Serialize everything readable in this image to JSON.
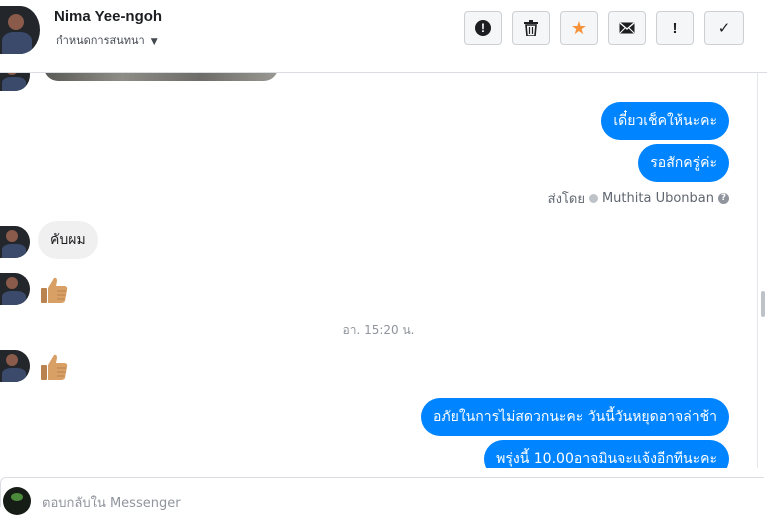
{
  "header": {
    "contact_name": "Nima Yee-ngoh",
    "subtitle": "กำหนดการสนทนา",
    "buttons": [
      {
        "icon": "exclamation-circle-icon",
        "glyph": "!"
      },
      {
        "icon": "trash-icon",
        "glyph": "🗑"
      },
      {
        "icon": "star-icon",
        "glyph": "★"
      },
      {
        "icon": "envelope-icon",
        "glyph": "✉"
      },
      {
        "icon": "exclamation-icon",
        "glyph": "!"
      },
      {
        "icon": "checkmark-icon",
        "glyph": "✓"
      }
    ]
  },
  "thread": {
    "outgoing_1": "เดี๋ยวเช็คให้นะคะ",
    "outgoing_2": "รอสักครู่ค่ะ",
    "sent_by_label": "ส่งโดย",
    "sent_by_name": "Muthita Ubonban",
    "incoming_1": "คับผม",
    "timestamp": "อา. 15:20 น.",
    "outgoing_3": "อภัยในการไม่สดวกนะคะ วันนี้วันหยุดอาจล่าช้า",
    "outgoing_4": "พรุ่งนี้ 10.00อาจมินจะแจ้งอีกทีนะคะ"
  },
  "composer": {
    "placeholder": "ตอบกลับใน Messenger"
  },
  "colors": {
    "accent": "#0084ff",
    "star": "#f7923b"
  }
}
